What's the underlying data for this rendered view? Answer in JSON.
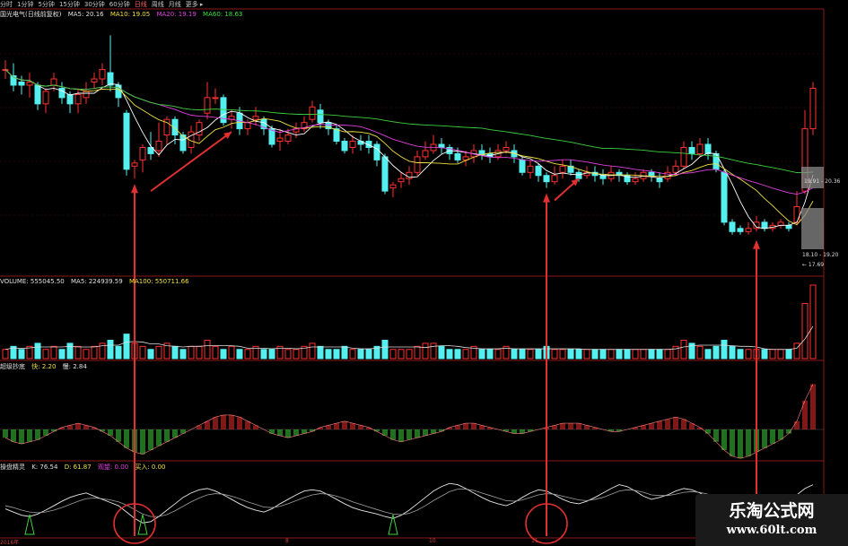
{
  "toolbar": {
    "periods": [
      "分时",
      "1分钟",
      "5分钟",
      "15分钟",
      "30分钟",
      "60分钟",
      "日线",
      "周线",
      "月线",
      "更多 ▸"
    ]
  },
  "kline_panel": {
    "title": "国光电气(日线前复权)",
    "ma5": "MA5: 20.16",
    "ma10": "MA10: 19.05",
    "ma20": "MA20: 19.19",
    "ma60": "MA60: 18.63",
    "price_tag_upper": "19.91 - 20.36",
    "price_tag_lower": "18.10 - 19.20",
    "price_tag_low": "← 17.69"
  },
  "volume_panel": {
    "title": "VOLUME: 555045.50",
    "ma5": "MA5: 224939.59",
    "ma10": "MA100: 550711.66"
  },
  "macd_panel": {
    "title": "超级抄底",
    "v1": "快: 2.20",
    "v2": "慢: 2.84"
  },
  "kdj_panel": {
    "title": "操盘精灵",
    "k": "K: 76.54",
    "d": "D: 61.87",
    "s1": "观望: 0.00",
    "s2": "买入: 0.00"
  },
  "date_axis": [
    "2016年",
    "8",
    "10",
    "11"
  ],
  "colors": {
    "up": "#ff3030",
    "down": "#54f0f0",
    "ma5": "#ffffff",
    "ma10": "#f0e040",
    "ma20": "#e040e0",
    "ma60": "#40d040",
    "macd_pos": "#ff3030",
    "macd_neg": "#40e040",
    "arrow": "#e03030"
  },
  "watermark": {
    "title": "乐淘公式网",
    "url": "www.60lt.com"
  },
  "chart_data": {
    "type": "candlestick",
    "title": "国光电气(日线前复权)",
    "ylim": [
      16.5,
      24.5
    ],
    "candles": [
      [
        22.9,
        22.9,
        23.2,
        22.6
      ],
      [
        22.7,
        22.4,
        23.1,
        22.2
      ],
      [
        22.5,
        22.4,
        22.7,
        22.1
      ],
      [
        22.4,
        22.5,
        22.8,
        22.0
      ],
      [
        22.4,
        21.8,
        22.5,
        21.6
      ],
      [
        21.8,
        22.2,
        22.3,
        21.5
      ],
      [
        22.4,
        22.6,
        22.8,
        22.2
      ],
      [
        22.3,
        22.0,
        22.5,
        21.8
      ],
      [
        22.1,
        21.8,
        22.2,
        21.5
      ],
      [
        21.8,
        22.1,
        22.3,
        21.5
      ],
      [
        22.0,
        22.2,
        22.5,
        21.8
      ],
      [
        22.5,
        22.6,
        22.8,
        22.3
      ],
      [
        22.6,
        22.9,
        23.1,
        22.4
      ],
      [
        22.8,
        22.4,
        24.0,
        22.2
      ],
      [
        22.4,
        22.0,
        22.5,
        21.7
      ],
      [
        21.5,
        19.7,
        21.6,
        19.5
      ],
      [
        19.8,
        19.9,
        20.0,
        19.4
      ],
      [
        20.0,
        20.4,
        20.5,
        19.6
      ],
      [
        20.4,
        20.2,
        20.9,
        20.0
      ],
      [
        20.3,
        20.6,
        21.2,
        20.1
      ],
      [
        20.8,
        21.3,
        21.4,
        20.5
      ],
      [
        21.3,
        20.8,
        21.4,
        20.5
      ],
      [
        20.8,
        20.3,
        20.9,
        20.2
      ],
      [
        20.4,
        20.9,
        21.1,
        20.2
      ],
      [
        20.8,
        21.2,
        21.3,
        20.6
      ],
      [
        21.5,
        22.0,
        22.5,
        21.3
      ],
      [
        22.0,
        22.0,
        22.3,
        21.8
      ],
      [
        22.0,
        21.2,
        22.1,
        21.1
      ],
      [
        21.3,
        21.4,
        21.6,
        21.0
      ],
      [
        21.5,
        21.0,
        21.7,
        20.8
      ],
      [
        21.0,
        21.2,
        21.3,
        20.8
      ],
      [
        21.3,
        21.4,
        21.7,
        21.1
      ],
      [
        21.3,
        21.0,
        21.4,
        20.8
      ],
      [
        21.0,
        20.5,
        21.1,
        20.4
      ],
      [
        20.6,
        20.7,
        21.0,
        20.3
      ],
      [
        20.6,
        20.8,
        21.0,
        20.5
      ],
      [
        20.9,
        21.0,
        21.2,
        20.7
      ],
      [
        21.0,
        21.2,
        21.4,
        20.9
      ],
      [
        21.3,
        21.7,
        21.9,
        21.2
      ],
      [
        21.6,
        21.2,
        21.8,
        21.0
      ],
      [
        21.2,
        21.0,
        21.3,
        20.8
      ],
      [
        21.0,
        20.6,
        21.1,
        20.5
      ],
      [
        20.6,
        20.3,
        20.7,
        20.2
      ],
      [
        20.4,
        20.6,
        20.8,
        20.2
      ],
      [
        20.6,
        20.5,
        20.8,
        20.3
      ],
      [
        20.6,
        20.4,
        20.8,
        20.2
      ],
      [
        20.5,
        20.0,
        20.6,
        19.8
      ],
      [
        20.1,
        19.0,
        20.2,
        18.9
      ],
      [
        19.1,
        19.2,
        19.3,
        18.8
      ],
      [
        19.3,
        19.4,
        19.6,
        19.1
      ],
      [
        19.4,
        19.6,
        19.8,
        19.2
      ],
      [
        19.6,
        20.1,
        20.3,
        19.5
      ],
      [
        20.1,
        20.3,
        20.6,
        20.0
      ],
      [
        20.3,
        20.5,
        20.8,
        20.2
      ],
      [
        20.5,
        20.4,
        20.7,
        20.2
      ],
      [
        20.4,
        20.2,
        20.5,
        20.0
      ],
      [
        20.2,
        20.0,
        20.4,
        19.9
      ],
      [
        20.0,
        20.1,
        20.3,
        19.8
      ],
      [
        20.1,
        20.3,
        20.5,
        19.9
      ],
      [
        20.3,
        20.2,
        20.5,
        20.0
      ],
      [
        20.2,
        20.1,
        20.4,
        19.9
      ],
      [
        20.1,
        20.3,
        20.5,
        20.0
      ],
      [
        20.3,
        20.4,
        20.6,
        20.2
      ],
      [
        20.3,
        20.1,
        20.5,
        19.9
      ],
      [
        20.0,
        19.6,
        20.1,
        19.5
      ],
      [
        19.6,
        19.8,
        20.0,
        19.4
      ],
      [
        19.8,
        19.5,
        19.9,
        19.3
      ],
      [
        19.5,
        19.3,
        19.6,
        19.1
      ],
      [
        19.3,
        19.5,
        19.8,
        19.2
      ],
      [
        19.6,
        19.8,
        20.0,
        19.4
      ],
      [
        19.8,
        19.6,
        20.0,
        19.5
      ],
      [
        19.6,
        19.4,
        19.7,
        19.3
      ],
      [
        19.5,
        19.6,
        19.8,
        19.4
      ],
      [
        19.6,
        19.5,
        19.8,
        19.3
      ],
      [
        19.5,
        19.4,
        19.7,
        19.2
      ],
      [
        19.4,
        19.6,
        19.8,
        19.3
      ],
      [
        19.6,
        19.5,
        19.7,
        19.3
      ],
      [
        19.5,
        19.3,
        19.6,
        19.2
      ],
      [
        19.3,
        19.4,
        19.6,
        19.2
      ],
      [
        19.4,
        19.6,
        19.7,
        19.3
      ],
      [
        19.6,
        19.5,
        19.7,
        19.3
      ],
      [
        19.4,
        19.3,
        19.6,
        19.1
      ],
      [
        19.4,
        19.6,
        19.8,
        19.3
      ],
      [
        19.6,
        19.8,
        20.0,
        19.5
      ],
      [
        19.8,
        20.4,
        20.6,
        19.7
      ],
      [
        20.4,
        20.2,
        20.6,
        20.0
      ],
      [
        20.2,
        20.5,
        20.7,
        20.1
      ],
      [
        20.5,
        20.2,
        20.7,
        20.0
      ],
      [
        20.2,
        19.7,
        20.3,
        19.6
      ],
      [
        19.6,
        18.0,
        19.7,
        17.9
      ],
      [
        18.0,
        17.7,
        18.1,
        17.6
      ],
      [
        17.8,
        17.7,
        17.9,
        17.6
      ],
      [
        17.7,
        17.8,
        18.0,
        17.6
      ],
      [
        17.8,
        18.0,
        18.2,
        17.7
      ],
      [
        18.0,
        17.8,
        18.1,
        17.7
      ],
      [
        17.8,
        17.9,
        18.0,
        17.7
      ],
      [
        17.9,
        18.0,
        18.1,
        17.8
      ],
      [
        17.9,
        17.8,
        18.0,
        17.7
      ],
      [
        18.0,
        18.5,
        19.0,
        17.9
      ],
      [
        19.0,
        21.0,
        21.6,
        18.9
      ],
      [
        21.0,
        22.3,
        22.5,
        20.8
      ]
    ],
    "volume": [
      3,
      4,
      3,
      4,
      5,
      3,
      4,
      3,
      5,
      4,
      3,
      4,
      5,
      6,
      4,
      8,
      5,
      4,
      3,
      4,
      5,
      4,
      3,
      4,
      4,
      6,
      4,
      3,
      4,
      3,
      3,
      4,
      3,
      3,
      4,
      3,
      3,
      4,
      5,
      4,
      3,
      3,
      4,
      3,
      3,
      3,
      4,
      6,
      3,
      3,
      3,
      4,
      5,
      5,
      4,
      3,
      3,
      3,
      4,
      3,
      3,
      3,
      4,
      3,
      3,
      3,
      3,
      4,
      3,
      3,
      3,
      3,
      3,
      3,
      3,
      3,
      3,
      3,
      3,
      3,
      3,
      3,
      3,
      4,
      6,
      5,
      4,
      3,
      4,
      6,
      4,
      3,
      3,
      3,
      3,
      3,
      3,
      3,
      5,
      18,
      24
    ],
    "macd": [
      -4,
      -6,
      -7,
      -6,
      -5,
      -3,
      -1,
      1,
      2,
      3,
      2,
      1,
      -1,
      -3,
      -6,
      -9,
      -11,
      -12,
      -10,
      -8,
      -6,
      -4,
      -2,
      0,
      2,
      4,
      6,
      7,
      7,
      6,
      4,
      2,
      0,
      -2,
      -3,
      -4,
      -3,
      -2,
      -1,
      1,
      2,
      3,
      4,
      3,
      2,
      1,
      -1,
      -3,
      -5,
      -6,
      -5,
      -4,
      -3,
      -2,
      -1,
      1,
      2,
      3,
      3,
      2,
      1,
      0,
      -1,
      -2,
      -2,
      -1,
      0,
      1,
      2,
      3,
      3,
      3,
      2,
      1,
      0,
      -1,
      -1,
      0,
      1,
      2,
      3,
      4,
      5,
      6,
      5,
      3,
      1,
      -2,
      -6,
      -10,
      -13,
      -14,
      -13,
      -11,
      -9,
      -7,
      -5,
      -2,
      4,
      14,
      22
    ],
    "kdj_k": [
      40,
      35,
      30,
      28,
      32,
      38,
      45,
      52,
      58,
      62,
      65,
      60,
      55,
      50,
      45,
      35,
      25,
      18,
      20,
      28,
      38,
      48,
      58,
      65,
      70,
      72,
      68,
      62,
      55,
      48,
      42,
      38,
      35,
      40,
      48,
      55,
      62,
      68,
      70,
      68,
      62,
      55,
      48,
      42,
      38,
      35,
      32,
      28,
      25,
      30,
      38,
      48,
      58,
      68,
      75,
      80,
      78,
      72,
      65,
      58,
      52,
      48,
      45,
      50,
      58,
      65,
      70,
      68,
      62,
      55,
      50,
      48,
      52,
      58,
      65,
      72,
      78,
      75,
      68,
      60,
      55,
      58,
      62,
      68,
      72,
      70,
      65,
      58,
      50,
      40,
      30,
      22,
      18,
      20,
      25,
      32,
      40,
      50,
      62,
      72,
      78
    ],
    "kdj_d": [
      45,
      42,
      38,
      35,
      34,
      35,
      38,
      42,
      47,
      52,
      56,
      57,
      56,
      54,
      51,
      46,
      39,
      32,
      28,
      28,
      31,
      37,
      44,
      51,
      57,
      62,
      64,
      63,
      60,
      56,
      51,
      47,
      43,
      42,
      44,
      48,
      53,
      58,
      62,
      64,
      63,
      60,
      56,
      51,
      47,
      43,
      39,
      35,
      32,
      31,
      33,
      38,
      45,
      53,
      60,
      67,
      71,
      71,
      69,
      65,
      61,
      57,
      53,
      52,
      54,
      58,
      62,
      64,
      63,
      60,
      57,
      54,
      53,
      55,
      58,
      63,
      68,
      70,
      69,
      66,
      62,
      61,
      61,
      63,
      66,
      67,
      66,
      63,
      59,
      53,
      45,
      37,
      31,
      27,
      26,
      28,
      32,
      38,
      46,
      55,
      63
    ]
  }
}
